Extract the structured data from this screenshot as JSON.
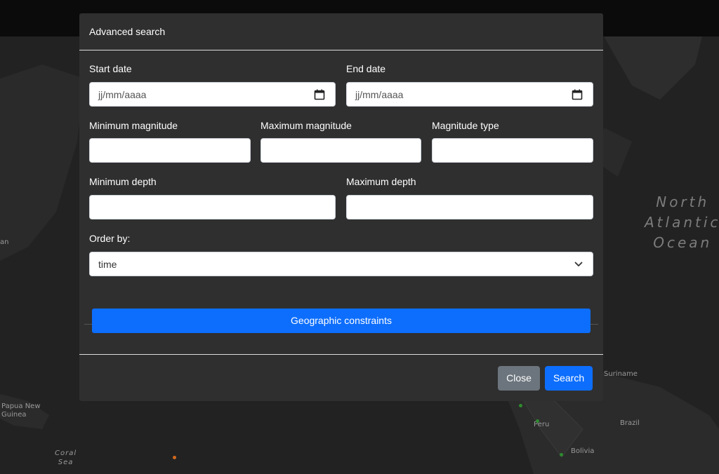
{
  "map": {
    "labels": {
      "papua": "Papua New\nGuinea",
      "coral": "Coral\nSea",
      "peru": "Peru",
      "brazil": "Brazil",
      "bolivia": "Bolivia",
      "suriname": "Suriname",
      "left_edge": "an"
    },
    "ocean": "North\nAtlantic\nOcean",
    "colors": {
      "background": "#222222",
      "land": "#2b2b2b",
      "quake_green": "#2e8b2e",
      "quake_orange": "#d2691e"
    }
  },
  "modal": {
    "title": "Advanced search",
    "fields": {
      "start_date": {
        "label": "Start date",
        "placeholder": "jj/mm/aaaa"
      },
      "end_date": {
        "label": "End date",
        "placeholder": "jj/mm/aaaa"
      },
      "min_magnitude": {
        "label": "Minimum magnitude",
        "value": ""
      },
      "max_magnitude": {
        "label": "Maximum magnitude",
        "value": ""
      },
      "magnitude_type": {
        "label": "Magnitude type",
        "value": ""
      },
      "min_depth": {
        "label": "Minimum depth",
        "value": ""
      },
      "max_depth": {
        "label": "Maximum depth",
        "value": ""
      },
      "order_by": {
        "label": "Order by:",
        "selected": "time"
      }
    },
    "geo_button": "Geographic constraints",
    "footer": {
      "close": "Close",
      "search": "Search"
    },
    "colors": {
      "primary": "#0d6efd",
      "secondary": "#6c757d",
      "modal_bg": "#2f2f2f"
    }
  }
}
